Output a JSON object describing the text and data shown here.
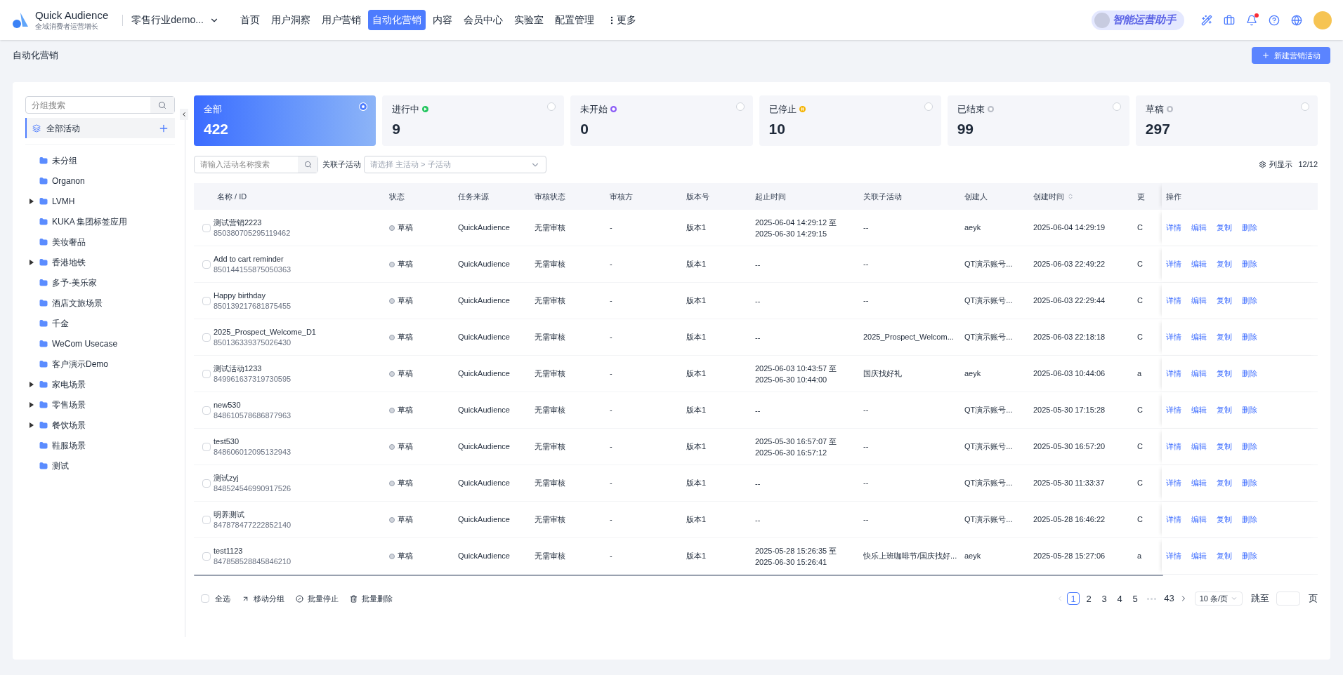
{
  "header": {
    "brand": "Quick Audience",
    "tagline": "全域消费者运营增长",
    "workspace": "零售行业demo...",
    "nav": [
      {
        "label": "首页",
        "selected": false
      },
      {
        "label": "用户洞察",
        "selected": false
      },
      {
        "label": "用户营销",
        "selected": false
      },
      {
        "label": "自动化营销",
        "selected": true
      },
      {
        "label": "内容",
        "selected": false
      },
      {
        "label": "会员中心",
        "selected": false
      },
      {
        "label": "实验室",
        "selected": false
      },
      {
        "label": "配置管理",
        "selected": false
      }
    ],
    "more": "更多",
    "assistant": "智能运营助手",
    "notification_dot": true
  },
  "breadcrumb": "自动化营销",
  "new_button": "新建营销活动",
  "sidebar": {
    "search_placeholder": "分组搜索",
    "root": {
      "label": "全部活动",
      "selected": true
    },
    "groups": [
      {
        "label": "未分组",
        "expandable": false
      },
      {
        "label": "Organon",
        "expandable": false
      },
      {
        "label": "LVMH",
        "expandable": true
      },
      {
        "label": "KUKA 集团标签应用",
        "expandable": false
      },
      {
        "label": "美妆奢品",
        "expandable": false
      },
      {
        "label": "香港地铁",
        "expandable": true
      },
      {
        "label": "多予-美乐家",
        "expandable": false
      },
      {
        "label": "酒店文旅场景",
        "expandable": false
      },
      {
        "label": "千金",
        "expandable": false
      },
      {
        "label": "WeCom Usecase",
        "expandable": false
      },
      {
        "label": "客户演示Demo",
        "expandable": false
      },
      {
        "label": "家电场景",
        "expandable": true
      },
      {
        "label": "零售场景",
        "expandable": true
      },
      {
        "label": "餐饮场景",
        "expandable": true
      },
      {
        "label": "鞋服场景",
        "expandable": false
      },
      {
        "label": "测试",
        "expandable": false
      }
    ]
  },
  "status_cards": [
    {
      "label": "全部",
      "count": "422",
      "kind": "all",
      "selected": true
    },
    {
      "label": "进行中",
      "count": "9",
      "kind": "running",
      "color": "#22c55e",
      "selected": false
    },
    {
      "label": "未开始",
      "count": "0",
      "kind": "pending",
      "color": "#8b5cf6",
      "selected": false
    },
    {
      "label": "已停止",
      "count": "10",
      "kind": "stopped",
      "color": "#f5b400",
      "selected": false
    },
    {
      "label": "已结束",
      "count": "99",
      "kind": "ended",
      "color": "#b8bcc6",
      "selected": false
    },
    {
      "label": "草稿",
      "count": "297",
      "kind": "draft",
      "color": "#b8bcc6",
      "selected": false
    }
  ],
  "filters": {
    "search_placeholder": "请输入活动名称搜索",
    "linked_label": "关联子活动",
    "linked_placeholder": "请选择 主活动 > 子活动",
    "columns_button": "列显示",
    "columns_count": "12/12"
  },
  "table": {
    "columns": [
      "名称 / ID",
      "状态",
      "任务来源",
      "审核状态",
      "审核方",
      "版本号",
      "起止时间",
      "关联子活动",
      "创建人",
      "创建时间",
      "更",
      "操作"
    ],
    "rows": [
      {
        "name": "测试营销2223",
        "id": "850380705295119462",
        "status": "草稿",
        "source": "QuickAudience",
        "review": "无需审核",
        "reviewer": "-",
        "version": "版本1",
        "time": [
          "2025-06-04 14:29:12 至",
          "2025-06-30 14:29:15"
        ],
        "linked": "--",
        "creator": "aeyk",
        "created": "2025-06-04 14:29:19",
        "column_11": "C",
        "checked": false,
        "actions": [
          "详情",
          "编辑",
          "复制",
          "删除"
        ]
      },
      {
        "name": "Add to cart reminder",
        "id": "850144155875050363",
        "status": "草稿",
        "source": "QuickAudience",
        "review": "无需审核",
        "reviewer": "-",
        "version": "版本1",
        "time": [
          "--"
        ],
        "linked": "--",
        "creator": "QT演示账号...",
        "created": "2025-06-03 22:49:22",
        "column_11": "C",
        "checked": false,
        "actions": [
          "详情",
          "编辑",
          "复制",
          "删除"
        ]
      },
      {
        "name": "Happy birthday",
        "id": "850139217681875455",
        "status": "草稿",
        "source": "QuickAudience",
        "review": "无需审核",
        "reviewer": "-",
        "version": "版本1",
        "time": [
          "--"
        ],
        "linked": "--",
        "creator": "QT演示账号...",
        "created": "2025-06-03 22:29:44",
        "column_11": "C",
        "checked": false,
        "actions": [
          "详情",
          "编辑",
          "复制",
          "删除"
        ]
      },
      {
        "name": "2025_Prospect_Welcome_D1",
        "id": "850136339375026430",
        "status": "草稿",
        "source": "QuickAudience",
        "review": "无需审核",
        "reviewer": "-",
        "version": "版本1",
        "time": [
          "--"
        ],
        "linked": "2025_Prospect_Welcom...",
        "creator": "QT演示账号...",
        "created": "2025-06-03 22:18:18",
        "column_11": "C",
        "checked": false,
        "actions": [
          "详情",
          "编辑",
          "复制",
          "删除"
        ]
      },
      {
        "name": "测试活动1233",
        "id": "849961637319730595",
        "status": "草稿",
        "source": "QuickAudience",
        "review": "无需审核",
        "reviewer": "-",
        "version": "版本1",
        "time": [
          "2025-06-03 10:43:57 至",
          "2025-06-30 10:44:00"
        ],
        "linked": "国庆找好礼",
        "creator": "aeyk",
        "created": "2025-06-03 10:44:06",
        "column_11": "a",
        "checked": false,
        "actions": [
          "详情",
          "编辑",
          "复制",
          "删除"
        ]
      },
      {
        "name": "new530",
        "id": "848610578686877963",
        "status": "草稿",
        "source": "QuickAudience",
        "review": "无需审核",
        "reviewer": "-",
        "version": "版本1",
        "time": [
          "--"
        ],
        "linked": "--",
        "creator": "QT演示账号...",
        "created": "2025-05-30 17:15:28",
        "column_11": "C",
        "checked": false,
        "actions": [
          "详情",
          "编辑",
          "复制",
          "删除"
        ]
      },
      {
        "name": "test530",
        "id": "848606012095132943",
        "status": "草稿",
        "source": "QuickAudience",
        "review": "无需审核",
        "reviewer": "-",
        "version": "版本1",
        "time": [
          "2025-05-30 16:57:07 至",
          "2025-06-30 16:57:12"
        ],
        "linked": "--",
        "creator": "QT演示账号...",
        "created": "2025-05-30 16:57:20",
        "column_11": "C",
        "checked": false,
        "actions": [
          "详情",
          "编辑",
          "复制",
          "删除"
        ]
      },
      {
        "name": "测试zyj",
        "id": "848524546990917526",
        "status": "草稿",
        "source": "QuickAudience",
        "review": "无需审核",
        "reviewer": "-",
        "version": "版本1",
        "time": [
          "--"
        ],
        "linked": "--",
        "creator": "QT演示账号...",
        "created": "2025-05-30 11:33:37",
        "column_11": "C",
        "checked": false,
        "actions": [
          "详情",
          "编辑",
          "复制",
          "删除"
        ]
      },
      {
        "name": "明养测试",
        "id": "847878477222852140",
        "status": "草稿",
        "source": "QuickAudience",
        "review": "无需审核",
        "reviewer": "-",
        "version": "版本1",
        "time": [
          "--"
        ],
        "linked": "--",
        "creator": "QT演示账号...",
        "created": "2025-05-28 16:46:22",
        "column_11": "C",
        "checked": false,
        "actions": [
          "详情",
          "编辑",
          "复制",
          "删除"
        ]
      },
      {
        "name": "test1123",
        "id": "847858528845846210",
        "status": "草稿",
        "source": "QuickAudience",
        "review": "无需审核",
        "reviewer": "-",
        "version": "版本1",
        "time": [
          "2025-05-28 15:26:35 至",
          "2025-06-30 15:26:41"
        ],
        "linked": "快乐上班咖啡节/国庆找好...",
        "creator": "aeyk",
        "created": "2025-05-28 15:27:06",
        "column_11": "a",
        "checked": false,
        "actions": [
          "详情",
          "编辑",
          "复制",
          "删除"
        ]
      }
    ]
  },
  "bulk": {
    "select_all": "全选",
    "select_all_checked": false,
    "actions": [
      {
        "label": "移动分组",
        "kind": "move"
      },
      {
        "label": "批量停止",
        "kind": "stop"
      },
      {
        "label": "批量删除",
        "kind": "delete"
      }
    ]
  },
  "pagination": {
    "pages": [
      {
        "label": "1",
        "selected": true
      },
      {
        "label": "2",
        "selected": false
      },
      {
        "label": "3",
        "selected": false
      },
      {
        "label": "4",
        "selected": false
      },
      {
        "label": "5",
        "selected": false
      }
    ],
    "last": "43",
    "page_size": "10 条/页",
    "jump_label": "跳至",
    "page_unit": "页"
  }
}
